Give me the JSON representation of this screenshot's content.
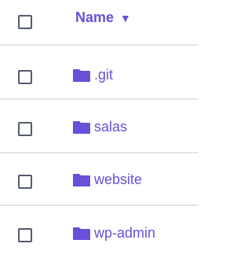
{
  "header": {
    "name_label": "Name",
    "sort_icon": "▼"
  },
  "rows": [
    {
      "name": ".git",
      "icon": "folder-icon"
    },
    {
      "name": "salas",
      "icon": "folder-icon"
    },
    {
      "name": "website",
      "icon": "folder-icon"
    },
    {
      "name": "wp-admin",
      "icon": "folder-icon"
    }
  ],
  "colors": {
    "accent": "#6a4fd8",
    "checkbox_border": "#555b6e",
    "divider": "#e3e3e3"
  }
}
